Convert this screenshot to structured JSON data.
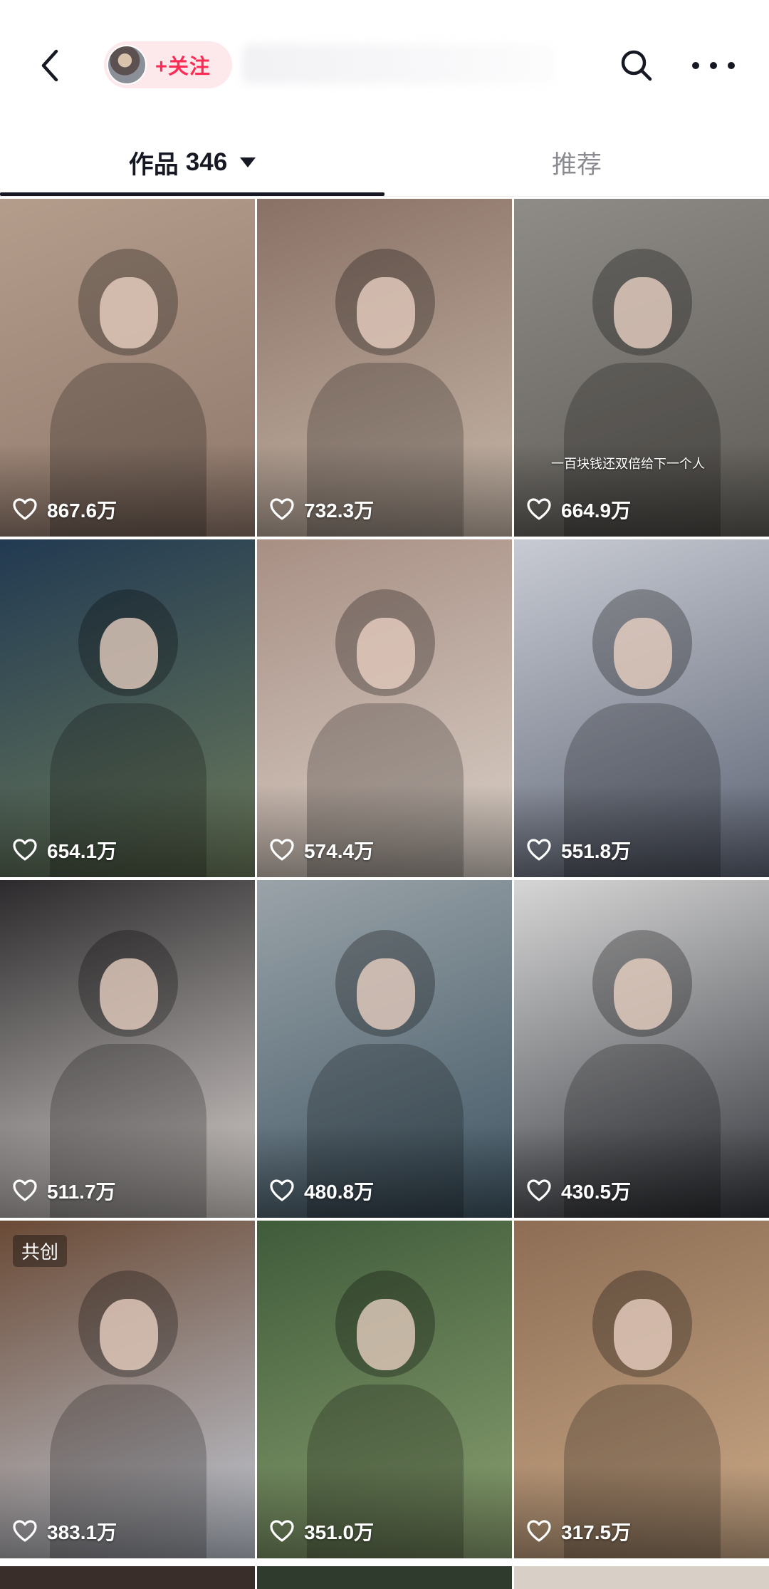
{
  "header": {
    "follow_label": "+关注",
    "icons": [
      "back-arrow-icon",
      "search-icon",
      "more-icon"
    ]
  },
  "tabs": {
    "works_label": "作品",
    "works_count": "346",
    "recommend_label": "推荐"
  },
  "videos": [
    {
      "likes": "867.6万",
      "colors": [
        "#b59d8c",
        "#8e776a"
      ]
    },
    {
      "likes": "732.3万",
      "colors": [
        "#8a7165",
        "#c7b7a9"
      ]
    },
    {
      "likes": "664.9万",
      "colors": [
        "#8f8c87",
        "#5e5b56"
      ],
      "caption": "一百块钱还双倍给下一个人"
    },
    {
      "likes": "654.1万",
      "colors": [
        "#223a52",
        "#6b7a5a"
      ]
    },
    {
      "likes": "574.4万",
      "colors": [
        "#a88f84",
        "#d9cfc6"
      ]
    },
    {
      "likes": "551.8万",
      "colors": [
        "#c8cbd3",
        "#5d6474"
      ]
    },
    {
      "likes": "511.7万",
      "colors": [
        "#2c2a2c",
        "#d8d2cf"
      ]
    },
    {
      "likes": "480.8万",
      "colors": [
        "#9aa3a8",
        "#3f5563"
      ]
    },
    {
      "likes": "430.5万",
      "colors": [
        "#d6d6d6",
        "#35373d"
      ]
    },
    {
      "likes": "383.1万",
      "colors": [
        "#6a4a36",
        "#c3cad6"
      ],
      "badge": "共创"
    },
    {
      "likes": "351.0万",
      "colors": [
        "#3f5b3a",
        "#8aa070"
      ]
    },
    {
      "likes": "317.5万",
      "colors": [
        "#8d6e55",
        "#caa886"
      ]
    }
  ],
  "colors": {
    "accent": "#fe2c55",
    "follow_bg": "#fde8ec",
    "text_primary": "#161823",
    "text_secondary": "#8a8b91"
  }
}
